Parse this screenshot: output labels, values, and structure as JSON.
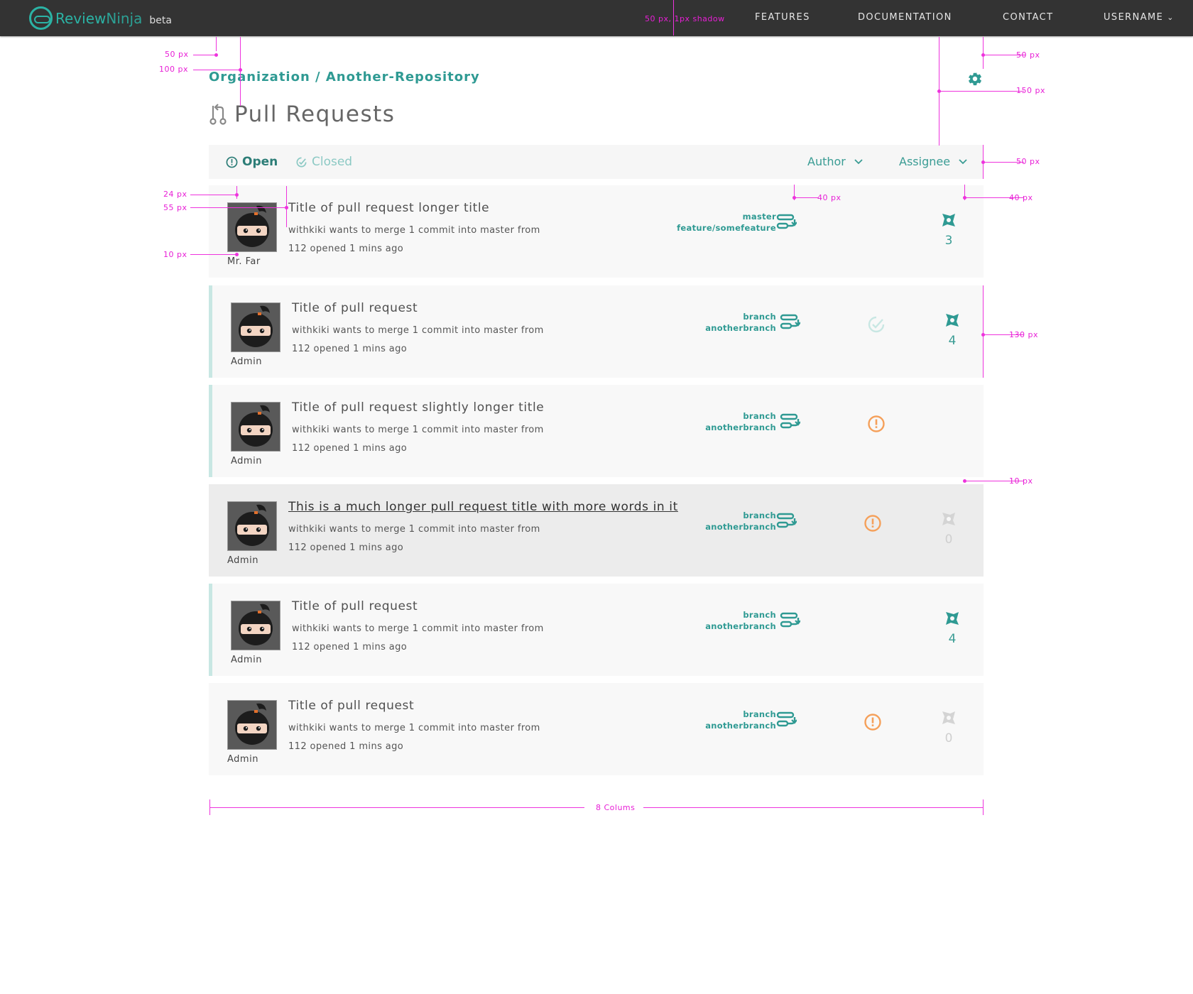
{
  "app": {
    "name_part1": "Review",
    "name_part2": "Ninja",
    "beta_label": "beta"
  },
  "nav": {
    "features": "FEATURES",
    "documentation": "DOCUMENTATION",
    "contact": "CONTACT",
    "username": "USERNAME"
  },
  "header": {
    "breadcrumb": "Organization / Another-Repository",
    "title": "Pull Requests"
  },
  "filters": {
    "open_label": "Open",
    "closed_label": "Closed",
    "author_label": "Author",
    "assignee_label": "Assignee"
  },
  "colors": {
    "teal": "#2f9a93",
    "orange": "#f5a05a",
    "light_teal": "#c8e7e3",
    "annotation": "#e81fd6",
    "topbar": "#333333"
  },
  "pull_requests": [
    {
      "author": "Mr. Far",
      "title": "Title of pull request longer title",
      "description": "withkiki wants to merge 1 commit into master from",
      "meta": "112 opened 1 mins ago",
      "branch_to": "master",
      "branch_from": "feature/somefeature",
      "status": "none",
      "stars": "3",
      "star_state": "active"
    },
    {
      "author": "Admin",
      "title": "Title of pull request",
      "description": "withkiki wants to merge 1 commit into master from",
      "meta": "112 opened 1 mins ago",
      "branch_to": "branch",
      "branch_from": "anotherbranch",
      "status": "closed",
      "stars": "4",
      "star_state": "active"
    },
    {
      "author": "Admin",
      "title": "Title of pull request slightly longer title",
      "description": "withkiki wants to merge 1 commit into master from",
      "meta": "112 opened 1 mins ago",
      "branch_to": "branch",
      "branch_from": "anotherbranch",
      "status": "open",
      "stars": "",
      "star_state": "none"
    },
    {
      "author": "Admin",
      "title": "This is a much longer pull request title with more words in it",
      "description": "withkiki wants to merge 1 commit into master from",
      "meta": "112 opened 1 mins ago",
      "branch_to": "branch",
      "branch_from": "anotherbranch",
      "status": "open",
      "stars": "0",
      "star_state": "inactive"
    },
    {
      "author": "Admin",
      "title": "Title of pull request",
      "description": "withkiki wants to merge 1 commit into master from",
      "meta": "112 opened 1 mins ago",
      "branch_to": "branch",
      "branch_from": "anotherbranch",
      "status": "none",
      "stars": "4",
      "star_state": "active"
    },
    {
      "author": "Admin",
      "title": "Title of pull request",
      "description": "withkiki wants to merge 1 commit into master from",
      "meta": "112 opened 1 mins ago",
      "branch_to": "branch",
      "branch_from": "anotherbranch",
      "status": "open",
      "stars": "0",
      "star_state": "inactive"
    }
  ],
  "annotations": {
    "topbar_spec": "50 px, 1px shadow",
    "left_50": "50 px",
    "left_100": "100 px",
    "right_50": "50 px",
    "right_150": "150 px",
    "filter_50": "50 px",
    "row_24": "24 px",
    "row_55": "55 px",
    "row_10": "10 px",
    "mid_40": "40 px",
    "right_40": "40 px",
    "row_130": "130 px",
    "gap_10": "10 px",
    "columns": "8 Colums"
  }
}
